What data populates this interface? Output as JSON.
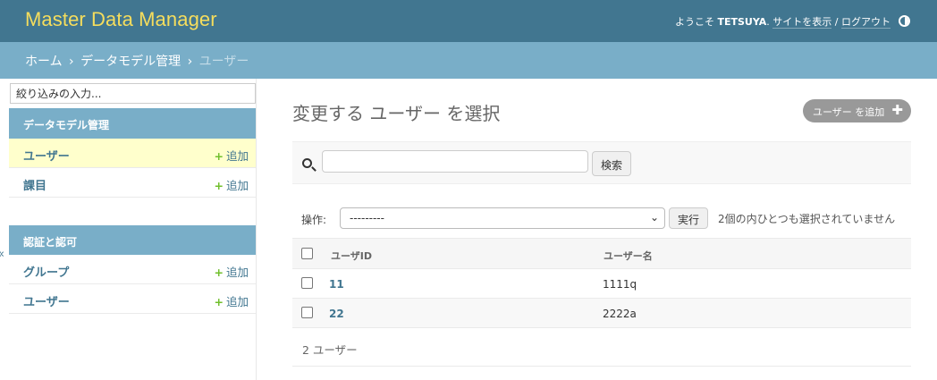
{
  "header": {
    "brand": "Master Data Manager",
    "welcome": "ようこそ",
    "username": "TETSUYA",
    "period": ".",
    "view_site": "サイトを表示",
    "slash": "/",
    "logout": "ログアウト"
  },
  "breadcrumbs": {
    "home": "ホーム",
    "app": "データモデル管理",
    "current": "ユーザー",
    "separator": "›"
  },
  "sidebar": {
    "filter_placeholder": "絞り込みの入力...",
    "collapse_glyph": "«",
    "apps": [
      {
        "caption": "データモデル管理",
        "models": [
          {
            "name": "ユーザー",
            "add": "追加",
            "active": true
          },
          {
            "name": "課目",
            "add": "追加",
            "active": false
          }
        ]
      },
      {
        "caption": "認証と認可",
        "models": [
          {
            "name": "グループ",
            "add": "追加",
            "active": false
          },
          {
            "name": "ユーザー",
            "add": "追加",
            "active": false
          }
        ]
      }
    ],
    "plus_glyph": "+"
  },
  "content": {
    "title": "変更する ユーザー を選択",
    "add_button": "ユーザー を追加",
    "add_glyph": "✚",
    "search_button": "検索",
    "action_label": "操作:",
    "action_selected": "---------",
    "run_button": "実行",
    "action_counter": "2個の内ひとつも選択されていません"
  },
  "table": {
    "columns": [
      "ユーザID",
      "ユーザー名"
    ],
    "rows": [
      {
        "id": "11",
        "name": "1111q"
      },
      {
        "id": "22",
        "name": "2222a"
      }
    ]
  },
  "paginator": {
    "count": "2 ユーザー"
  },
  "colors": {
    "header_bg": "#417690",
    "brand": "#f5dd5d",
    "breadcrumbs_bg": "#79aec8",
    "link": "#417690",
    "add_plus": "#70bf2b",
    "active_row": "#ffffcc"
  }
}
